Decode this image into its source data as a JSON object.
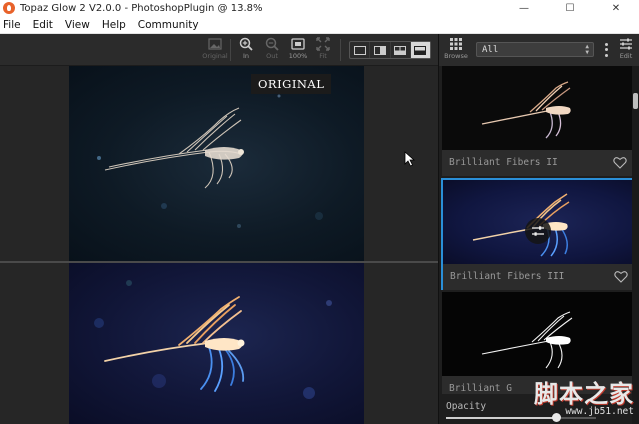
{
  "window": {
    "title": "Topaz Glow 2 V2.0.0 - PhotoshopPlugin @ 13.8%",
    "minimize_glyph": "—",
    "maximize_glyph": "☐",
    "close_glyph": "✕"
  },
  "menu": {
    "items": [
      "File",
      "Edit",
      "View",
      "Help",
      "Community"
    ]
  },
  "toolbar": {
    "original_label": "Original",
    "zoom_in_label": "In",
    "zoom_out_label": "Out",
    "zoom_100_label": "100%",
    "fit_label": "Fit",
    "view_modes": [
      "single-view",
      "side-by-side",
      "split-vertical",
      "split-horizontal"
    ],
    "active_view_mode": "split-horizontal"
  },
  "canvas": {
    "original_badge": "ORIGINAL"
  },
  "panel": {
    "browse_label": "Browse",
    "edit_label": "Edit",
    "filter_value": "All",
    "presets": [
      {
        "name": "Brilliant Fibers II"
      },
      {
        "name": "Brilliant Fibers III"
      },
      {
        "name": "Brilliant G"
      }
    ],
    "selected_preset_index": 1,
    "opacity_label": "Opacity",
    "opacity_value_fraction": 0.73
  },
  "watermark": {
    "chinese_text": "脚本之家",
    "url_text": "www.jb51.net"
  },
  "colors": {
    "accent_selected": "#2a8fd8",
    "app_icon": "#e8622a"
  }
}
